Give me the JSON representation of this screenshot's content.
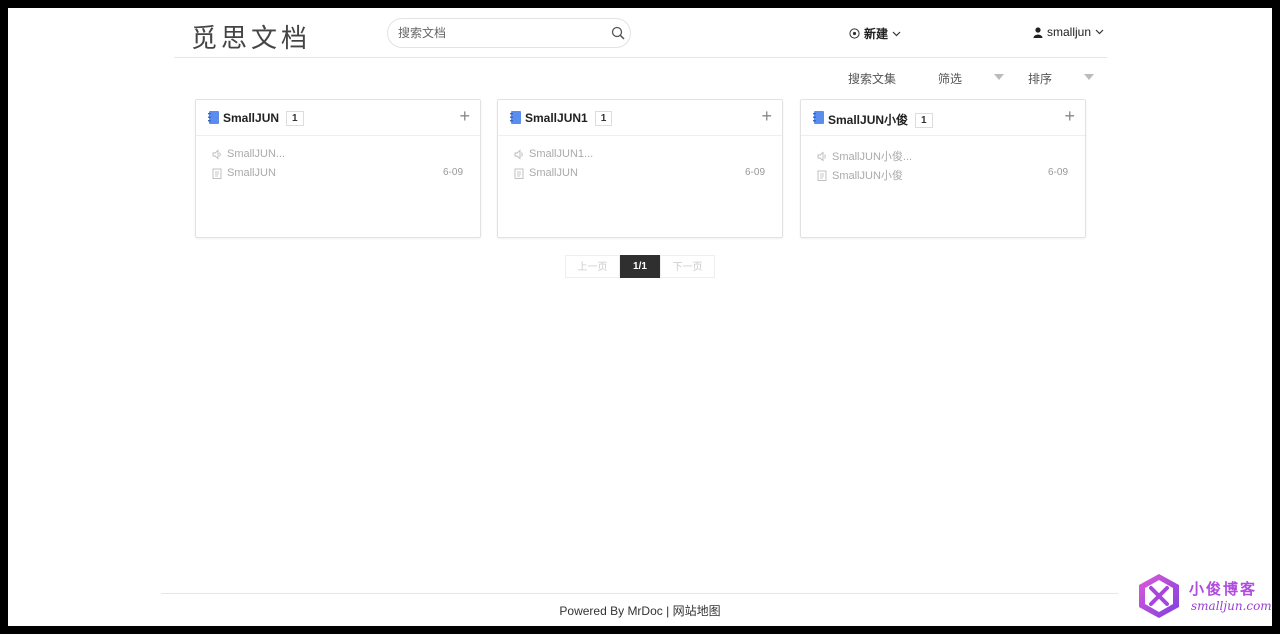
{
  "header": {
    "logo_text": "觅思文档",
    "search_placeholder": "搜索文档",
    "new_label": "新建",
    "username": "smalljun"
  },
  "toolbar": {
    "search_collections": "搜索文集",
    "filter": "筛选",
    "sort": "排序"
  },
  "cards": [
    {
      "title": "SmallJUN",
      "count": "1",
      "doc1": "SmallJUN...",
      "doc2": "SmallJUN",
      "date": "6-09"
    },
    {
      "title": "SmallJUN1",
      "count": "1",
      "doc1": "SmallJUN1...",
      "doc2": "SmallJUN",
      "date": "6-09"
    },
    {
      "title": "SmallJUN小俊",
      "count": "1",
      "doc1": "SmallJUN小俊...",
      "doc2": "SmallJUN小俊",
      "date": "6-09"
    }
  ],
  "pagination": {
    "prev": "上一页",
    "current": "1/1",
    "next": "下一页"
  },
  "footer": {
    "powered": "Powered By MrDoc",
    "separator": " | ",
    "sitemap": "网站地图"
  },
  "watermark": {
    "name": "小俊博客",
    "url": "smalljun.com"
  },
  "colors": {
    "accent_book": "#5b8def",
    "watermark": "#a646dd"
  }
}
